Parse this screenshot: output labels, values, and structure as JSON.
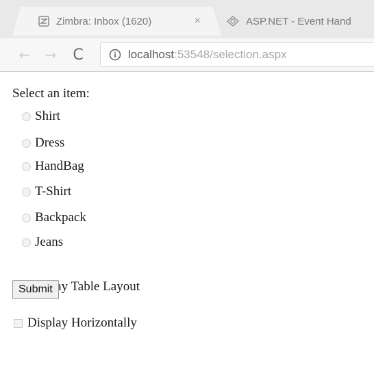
{
  "browser": {
    "tabs": [
      {
        "title": "Zimbra: Inbox (1620)",
        "icon": "zimbra-icon",
        "active": true,
        "close_glyph": "×"
      },
      {
        "title": "ASP.NET - Event Hand",
        "icon": "aspnet-icon",
        "active": false
      }
    ],
    "nav": {
      "back_glyph": "←",
      "forward_glyph": "→",
      "reload_glyph": "C"
    },
    "address": {
      "host": "localhost",
      "rest": ":53548/selection.aspx"
    }
  },
  "form": {
    "prompt": "Select an item:",
    "items": [
      {
        "label": "Shirt",
        "selected": false
      },
      {
        "label": "Dress",
        "selected": false
      },
      {
        "label": "HandBag",
        "selected": false
      },
      {
        "label": "T-Shirt",
        "selected": false
      },
      {
        "label": "Backpack",
        "selected": false
      },
      {
        "label": "Jeans",
        "selected": false
      }
    ],
    "options": [
      {
        "label": "Display Table Layout",
        "checked": true
      },
      {
        "label": "Display Horizontally",
        "checked": false
      }
    ],
    "submit_label": "Submit"
  }
}
